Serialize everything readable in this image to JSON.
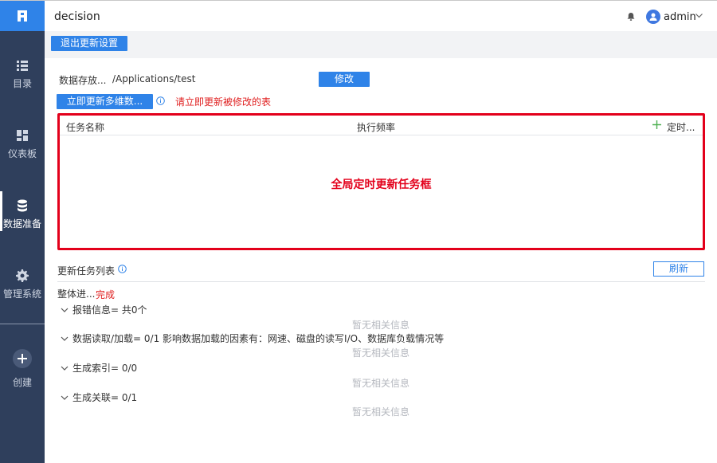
{
  "app": {
    "title": "decision",
    "user": "admin"
  },
  "sidebar": {
    "items": [
      {
        "label": "目录",
        "icon": "list-icon"
      },
      {
        "label": "仪表板",
        "icon": "dashboard-icon"
      },
      {
        "label": "数据准备",
        "icon": "database-icon",
        "active": true
      },
      {
        "label": "管理系统",
        "icon": "gear-icon"
      }
    ],
    "create_label": "创建"
  },
  "toolbar": {
    "exit_label": "退出更新设置"
  },
  "storage": {
    "label": "数据存放...",
    "path": "/Applications/test",
    "modify_label": "修改"
  },
  "update_now": {
    "button_label": "立即更新多维数...",
    "hint": "请立即更新被修改的表"
  },
  "task_table": {
    "columns": [
      "任务名称",
      "执行频率",
      "定时..."
    ],
    "overlay_annotation": "全局定时更新任务框"
  },
  "task_list": {
    "title": "更新任务列表",
    "refresh_label": "刷新",
    "progress_label": "整体进...",
    "progress_status": "完成",
    "sections": [
      {
        "label": "报错信息= 共0个",
        "empty": "暂无相关信息"
      },
      {
        "label": "数据读取/加载= 0/1 影响数据加载的因素有：网速、磁盘的读写I/O、数据库负载情况等",
        "empty": "暂无相关信息"
      },
      {
        "label": "生成索引= 0/0",
        "empty": "暂无相关信息"
      },
      {
        "label": "生成关联= 0/1",
        "empty": "暂无相关信息"
      }
    ]
  },
  "colors": {
    "sidebar_bg": "#2f3f5c",
    "accent": "#2f83e8",
    "annotation_red": "#e3001b",
    "add_green": "#4caf50"
  }
}
